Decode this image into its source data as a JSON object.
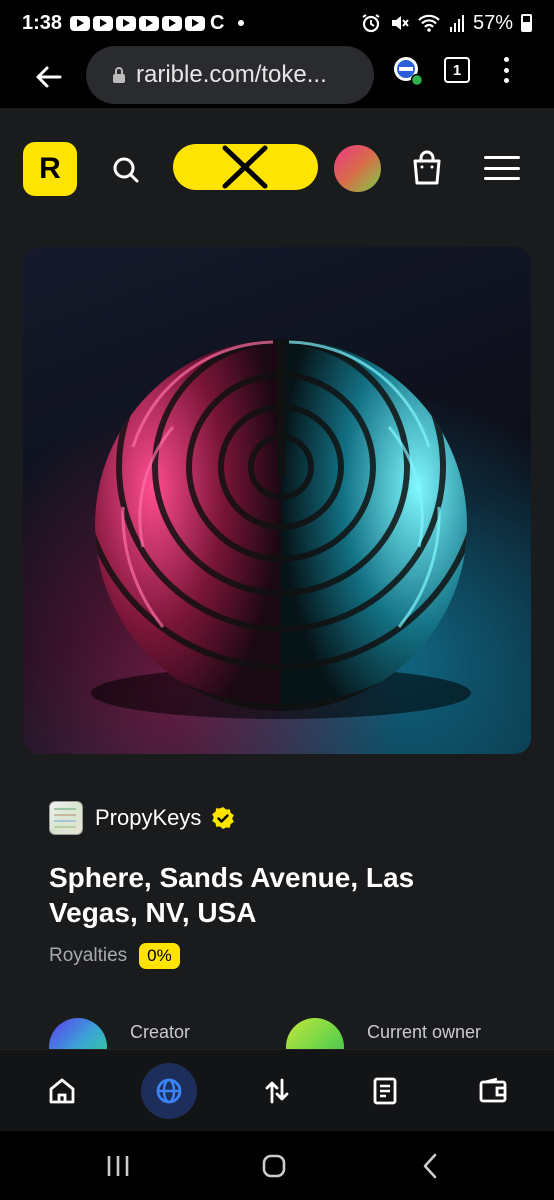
{
  "status_bar": {
    "time": "1:38",
    "carrier_glyph": "C",
    "battery": "57%"
  },
  "browser": {
    "url": "rarible.com/toke...",
    "tab_count": "1"
  },
  "site": {
    "logo_letter": "R",
    "brand_color": "#fee400"
  },
  "token": {
    "collection": "PropyKeys",
    "title": "Sphere, Sands Avenue, Las Vegas, NV, USA",
    "royalties_label": "Royalties",
    "royalties_value": "0%",
    "creator_label": "Creator",
    "owner_label": "Current owner"
  },
  "bottom_nav": {
    "items": [
      "home-icon",
      "globe-icon",
      "transfer-arrows-icon",
      "document-icon",
      "wallet-icon"
    ],
    "active_index": 1
  },
  "system_nav": [
    "recents-icon",
    "home-button-icon",
    "back-button-icon"
  ]
}
